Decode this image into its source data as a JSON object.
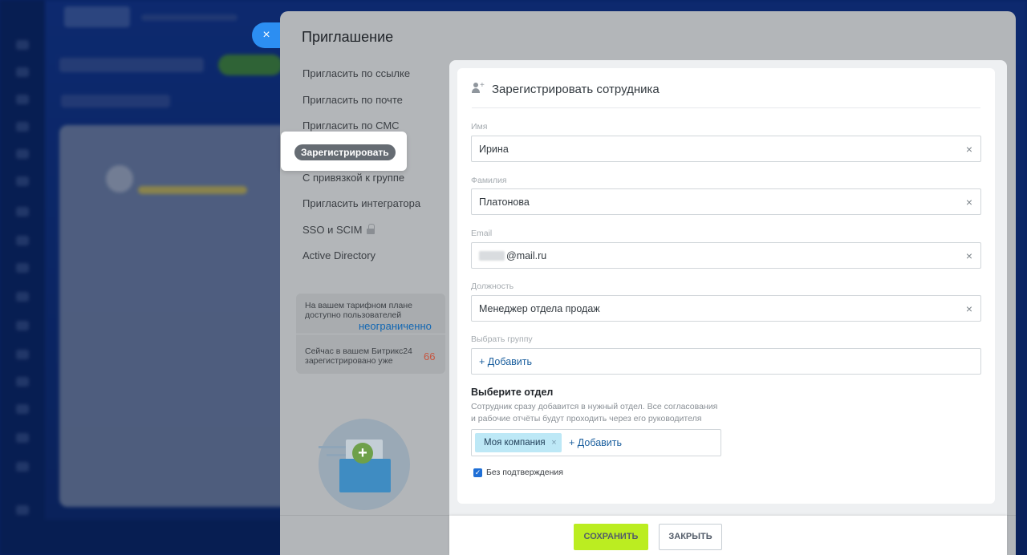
{
  "panel": {
    "title": "Приглашение",
    "close_icon": "×"
  },
  "left_menu": {
    "items": [
      "Пригласить по ссылке",
      "Пригласить по почте",
      "Пригласить по СМС",
      "Зарегистрировать",
      "С привязкой к группе",
      "Пригласить интегратора",
      "SSO и SCIM",
      "Active Directory"
    ],
    "active_index": 3
  },
  "info": {
    "tariff_line1": "На вашем тарифном плане",
    "tariff_line2": "доступно пользователей",
    "tariff_value": "неограниченно",
    "registered_line1": "Сейчас в вашем Битрикс24",
    "registered_line2": "зарегистрировано уже",
    "registered_value": "66"
  },
  "form": {
    "title": "Зарегистрировать сотрудника",
    "fields": {
      "first_name": {
        "label": "Имя",
        "value": "Ирина"
      },
      "last_name": {
        "label": "Фамилия",
        "value": "Платонова"
      },
      "email": {
        "label": "Email",
        "value": "@mail.ru"
      },
      "position": {
        "label": "Должность",
        "value": "Менеджер отдела продаж"
      },
      "group": {
        "label": "Выбрать группу",
        "add_label": "+ Добавить"
      }
    },
    "clear_icon": "×",
    "department": {
      "title": "Выберите отдел",
      "desc_line1": "Сотрудник сразу добавится в нужный отдел. Все согласования",
      "desc_line2": "и рабочие отчёты будут проходить через его руководителя",
      "tag": "Моя компания",
      "tag_remove": "×",
      "add_label": "+ Добавить"
    },
    "no_confirm": {
      "label": "Без подтверждения",
      "checked": true
    }
  },
  "footer": {
    "save_label": "СОХРАНИТЬ",
    "close_label": "ЗАКРЫТЬ"
  },
  "colors": {
    "accent_blue": "#2c8ef2",
    "save_green": "#bbed21",
    "link_blue": "#1b5f9e"
  }
}
